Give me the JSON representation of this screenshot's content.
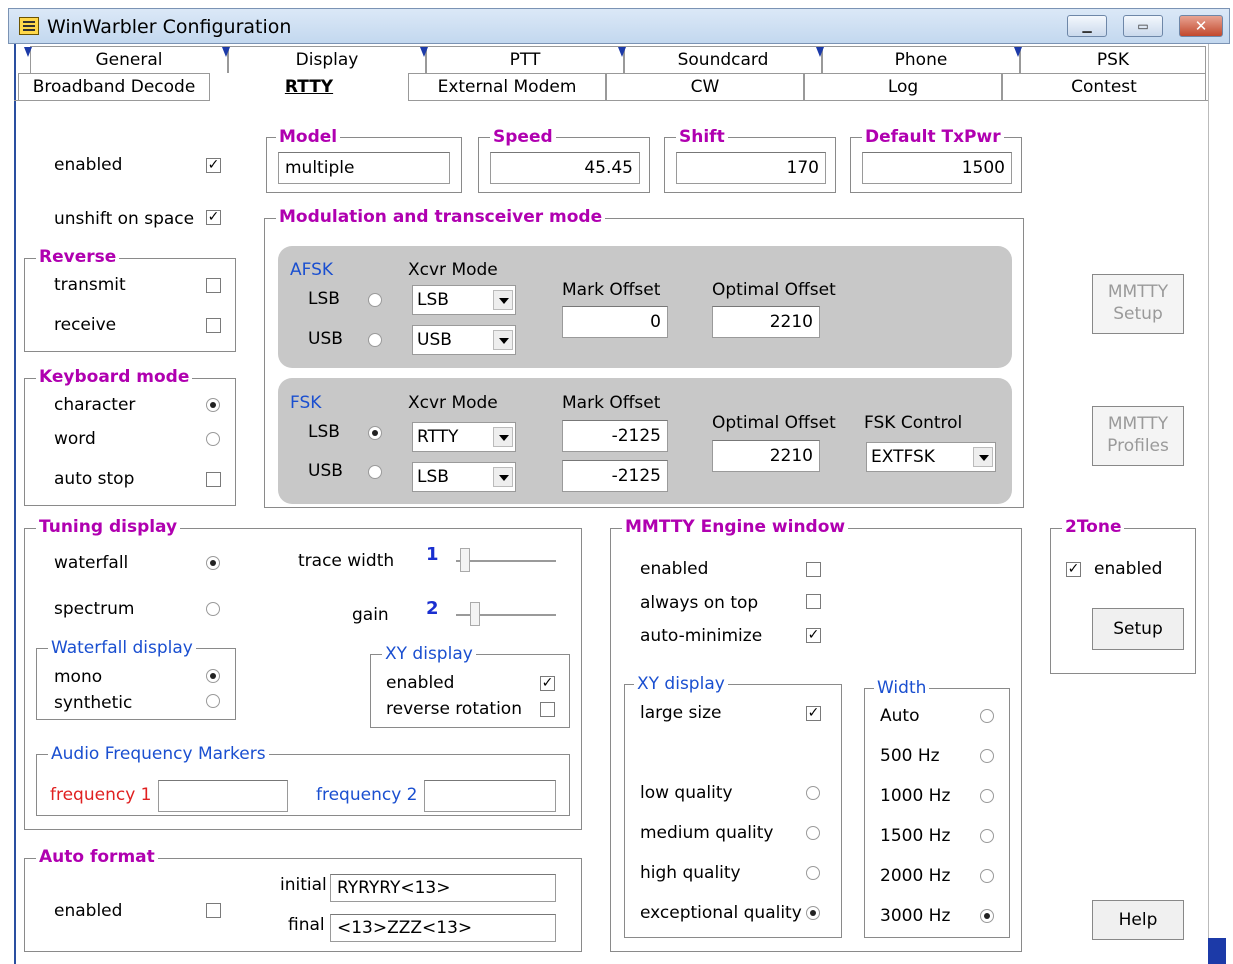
{
  "window": {
    "title": "WinWarbler Configuration"
  },
  "tabs_row1": [
    "General",
    "Display",
    "PTT",
    "Soundcard",
    "Phone",
    "PSK"
  ],
  "tabs_row2": [
    "Broadband Decode",
    "RTTY",
    "External Modem",
    "CW",
    "Log",
    "Contest"
  ],
  "top": {
    "enabled_label": "enabled",
    "enabled": true,
    "unshift_label": "unshift on space",
    "unshift": true,
    "model_legend": "Model",
    "model_value": "multiple",
    "speed_legend": "Speed",
    "speed_value": "45.45",
    "shift_legend": "Shift",
    "shift_value": "170",
    "txpwr_legend": "Default TxPwr",
    "txpwr_value": "1500"
  },
  "reverse": {
    "legend": "Reverse",
    "transmit": "transmit",
    "receive": "receive"
  },
  "keyboard": {
    "legend": "Keyboard mode",
    "character": "character",
    "word": "word",
    "autostop": "auto stop"
  },
  "modulation": {
    "legend": "Modulation and transceiver mode",
    "afsk": {
      "title": "AFSK",
      "xcvr_mode": "Xcvr Mode",
      "lsb": "LSB",
      "usb": "USB",
      "lsb_sel": "LSB",
      "usb_sel": "USB",
      "mark_offset": "Mark Offset",
      "mark_value": "0",
      "optimal_offset": "Optimal Offset",
      "optimal_value": "2210"
    },
    "fsk": {
      "title": "FSK",
      "xcvr_mode": "Xcvr Mode",
      "lsb": "LSB",
      "usb": "USB",
      "lsb_sel": "RTTY",
      "usb_sel": "LSB",
      "mark_offset": "Mark Offset",
      "mark_lsb": "-2125",
      "mark_usb": "-2125",
      "optimal_offset": "Optimal Offset",
      "optimal_value": "2210",
      "fsk_control": "FSK Control",
      "fsk_control_value": "EXTFSK"
    }
  },
  "mmtty_buttons": {
    "setup": "MMTTY\nSetup",
    "setup_l1": "MMTTY",
    "setup_l2": "Setup",
    "profiles_l1": "MMTTY",
    "profiles_l2": "Profiles"
  },
  "tuning": {
    "legend": "Tuning display",
    "waterfall": "waterfall",
    "spectrum": "spectrum",
    "trace_width": "trace width",
    "trace_value": "1",
    "gain": "gain",
    "gain_value": "2",
    "wf_legend": "Waterfall display",
    "mono": "mono",
    "synthetic": "synthetic",
    "xy_legend": "XY display",
    "xy_enabled": "enabled",
    "xy_reverse": "reverse rotation",
    "afm_legend": "Audio Frequency Markers",
    "freq1": "frequency 1",
    "freq2": "frequency 2"
  },
  "autoformat": {
    "legend": "Auto format",
    "enabled": "enabled",
    "initial": "initial",
    "initial_value": "RYRYRY<13>",
    "final": "final",
    "final_value": "<13>ZZZ<13>"
  },
  "engine": {
    "legend": "MMTTY Engine window",
    "enabled": "enabled",
    "always_on_top": "always on top",
    "auto_minimize": "auto-minimize",
    "xy_legend": "XY display",
    "large_size": "large size",
    "low": "low quality",
    "medium": "medium quality",
    "high": "high quality",
    "exceptional": "exceptional quality",
    "width_legend": "Width",
    "widths": [
      "Auto",
      "500 Hz",
      "1000 Hz",
      "1500 Hz",
      "2000 Hz",
      "3000 Hz"
    ]
  },
  "twotone": {
    "legend": "2Tone",
    "enabled": "enabled",
    "setup": "Setup"
  },
  "help": "Help"
}
